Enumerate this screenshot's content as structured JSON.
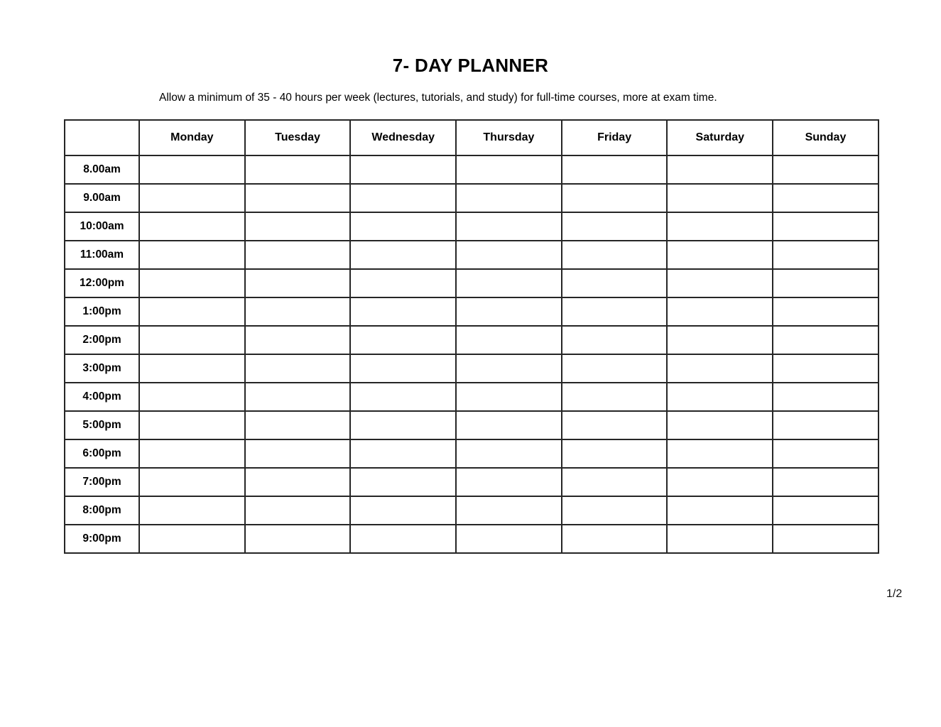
{
  "document": {
    "title": "7- DAY PLANNER",
    "subtitle": "Allow a minimum of 35 - 40 hours per week (lectures, tutorials, and study) for full-time courses, more at exam time.",
    "page_indicator": "1/2",
    "background_color": "#ffffff",
    "text_color": "#000000",
    "border_color": "#262626"
  },
  "table": {
    "corner_header": "",
    "day_headers": [
      "Monday",
      "Tuesday",
      "Wednesday",
      "Thursday",
      "Friday",
      "Saturday",
      "Sunday"
    ],
    "time_slots": [
      "8.00am",
      "9.00am",
      "10:00am",
      "11:00am",
      "12:00pm",
      "1:00pm",
      "2:00pm",
      "3:00pm",
      "4:00pm",
      "5:00pm",
      "6:00pm",
      "7:00pm",
      "8:00pm",
      "9:00pm"
    ],
    "entries": [
      [
        "",
        "",
        "",
        "",
        "",
        "",
        ""
      ],
      [
        "",
        "",
        "",
        "",
        "",
        "",
        ""
      ],
      [
        "",
        "",
        "",
        "",
        "",
        "",
        ""
      ],
      [
        "",
        "",
        "",
        "",
        "",
        "",
        ""
      ],
      [
        "",
        "",
        "",
        "",
        "",
        "",
        ""
      ],
      [
        "",
        "",
        "",
        "",
        "",
        "",
        ""
      ],
      [
        "",
        "",
        "",
        "",
        "",
        "",
        ""
      ],
      [
        "",
        "",
        "",
        "",
        "",
        "",
        ""
      ],
      [
        "",
        "",
        "",
        "",
        "",
        "",
        ""
      ],
      [
        "",
        "",
        "",
        "",
        "",
        "",
        ""
      ],
      [
        "",
        "",
        "",
        "",
        "",
        "",
        ""
      ],
      [
        "",
        "",
        "",
        "",
        "",
        "",
        ""
      ],
      [
        "",
        "",
        "",
        "",
        "",
        "",
        ""
      ],
      [
        "",
        "",
        "",
        "",
        "",
        "",
        ""
      ]
    ]
  }
}
